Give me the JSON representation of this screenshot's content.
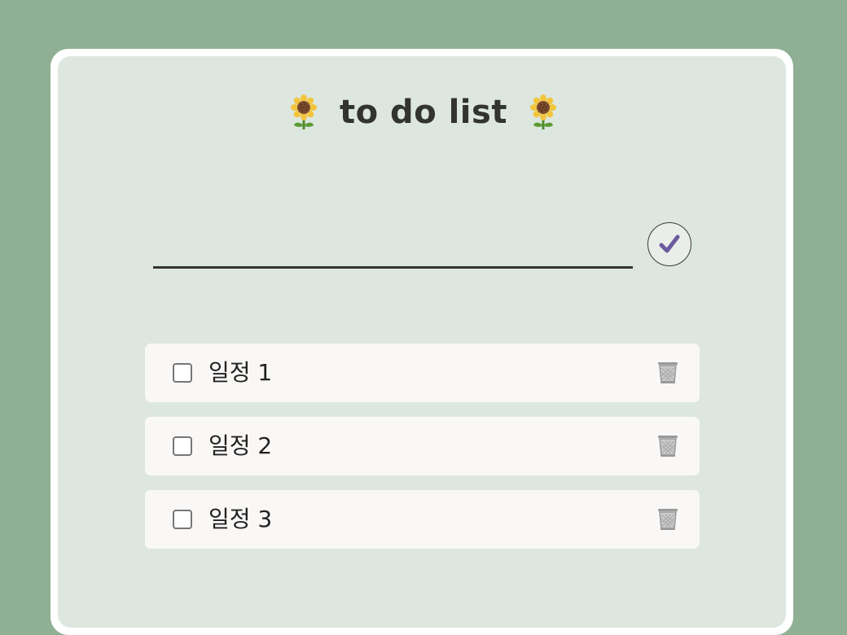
{
  "header": {
    "title": "to do list",
    "left_icon": "sunflower-icon",
    "right_icon": "sunflower-icon"
  },
  "new_todo": {
    "value": "",
    "placeholder": "",
    "submit_icon": "checkmark-icon"
  },
  "todos": [
    {
      "label": "일정 1",
      "checked": false,
      "delete_icon": "trash-icon"
    },
    {
      "label": "일정 2",
      "checked": false,
      "delete_icon": "trash-icon"
    },
    {
      "label": "일정 3",
      "checked": false,
      "delete_icon": "trash-icon"
    }
  ],
  "colors": {
    "background": "#8fb094",
    "card_border": "#ffffff",
    "card_fill": "#dde7e0",
    "item_fill": "#faf8f6",
    "text": "#333330",
    "check_accent": "#6b5b9e"
  }
}
